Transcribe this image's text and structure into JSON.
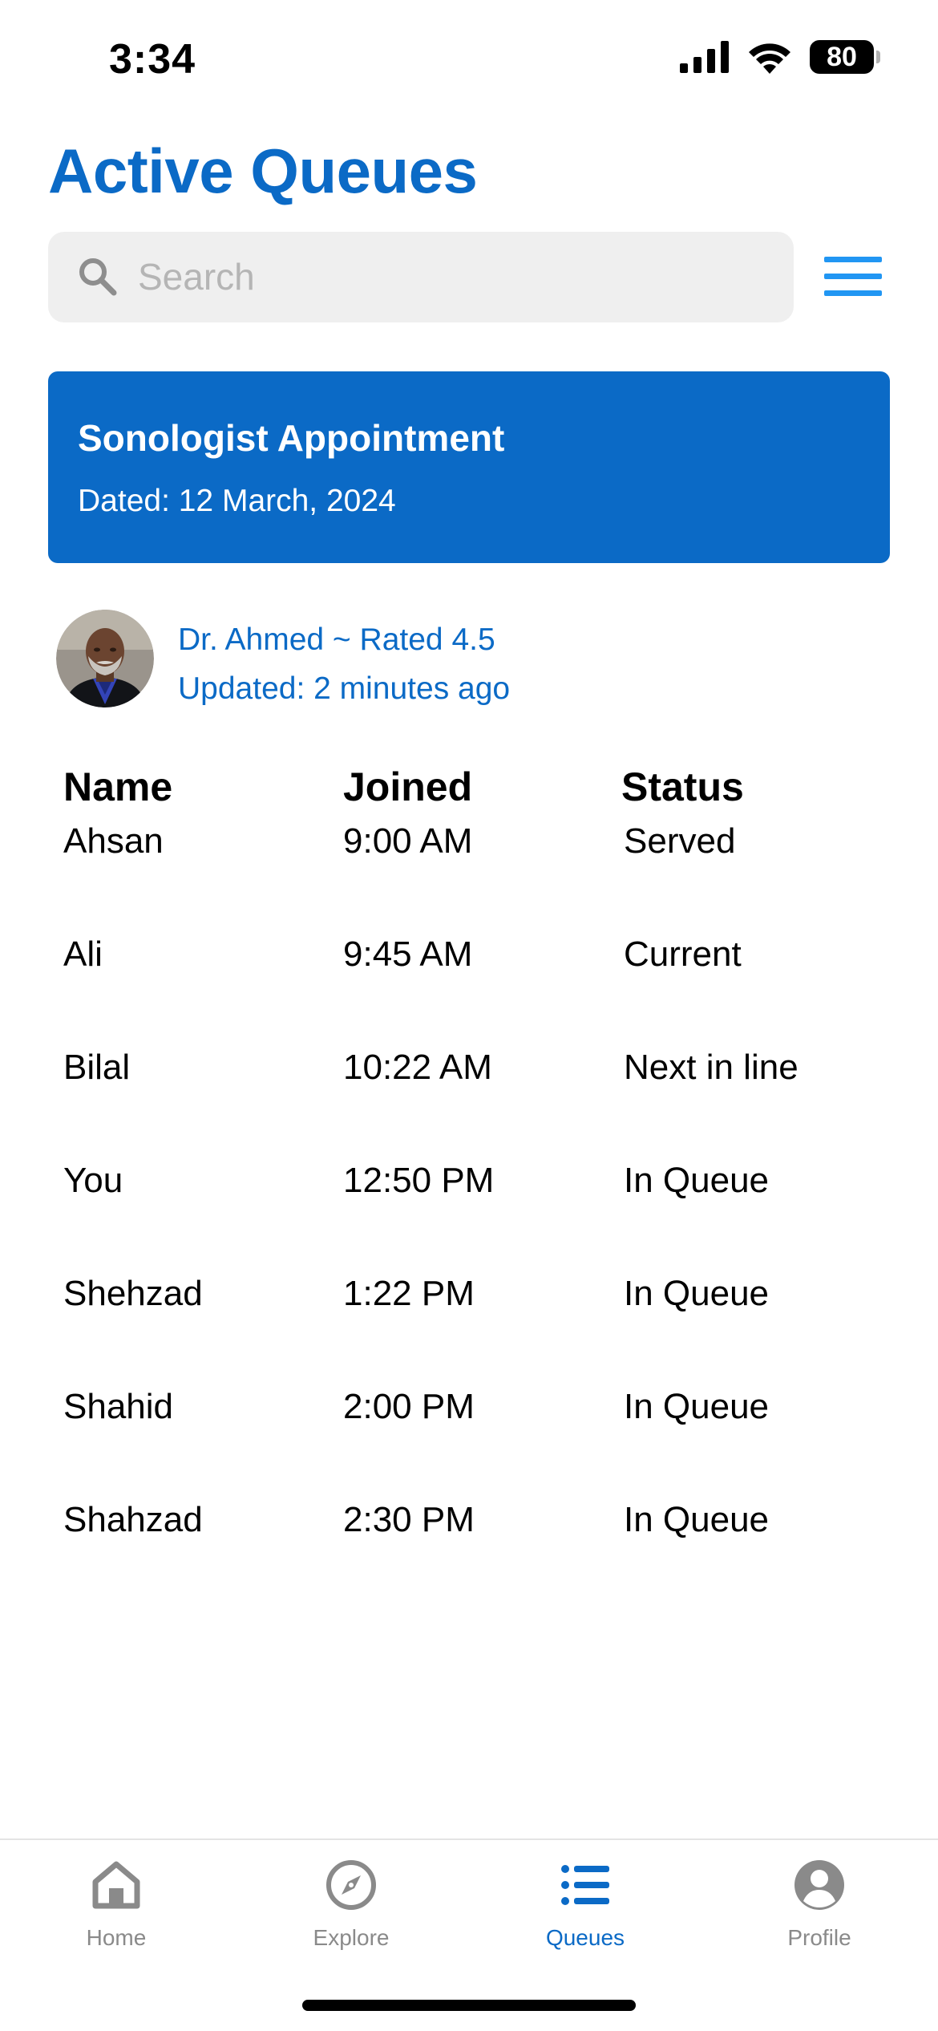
{
  "status_bar": {
    "time": "3:34",
    "battery": "80",
    "icons": [
      "signal-icon",
      "wifi-icon",
      "battery-icon"
    ]
  },
  "header": {
    "title": "Active Queues"
  },
  "search": {
    "placeholder": "Search",
    "value": "",
    "icon": "search-icon"
  },
  "menu": {
    "icon": "hamburger-menu-icon"
  },
  "appointment": {
    "title": "Sonologist Appointment",
    "date": "Dated: 12 March, 2024"
  },
  "doctor": {
    "info": "Dr. Ahmed ~ Rated 4.5",
    "updated": "Updated: 2 minutes ago"
  },
  "table": {
    "headers": [
      "Name",
      "Joined",
      "Status"
    ],
    "rows": [
      [
        "Ahsan",
        "9:00 AM",
        "Served"
      ],
      [
        "Ali",
        "9:45 AM",
        "Current"
      ],
      [
        "Bilal",
        "10:22 AM",
        "Next in line"
      ],
      [
        "You",
        "12:50 PM",
        "In Queue"
      ],
      [
        "Shehzad",
        "1:22 PM",
        "In Queue"
      ],
      [
        "Shahid",
        "2:00 PM",
        "In Queue"
      ],
      [
        "Shahzad",
        "2:30 PM",
        "In Queue"
      ]
    ]
  },
  "tabs": [
    {
      "label": "Home",
      "icon": "home-icon",
      "active": false
    },
    {
      "label": "Explore",
      "icon": "compass-icon",
      "active": false
    },
    {
      "label": "Queues",
      "icon": "list-icon",
      "active": true
    },
    {
      "label": "Profile",
      "icon": "profile-icon",
      "active": false
    }
  ],
  "colors": {
    "accent": "#0b6ac6",
    "menu_icon": "#2196f3",
    "tab_inactive": "#8a8a8a",
    "search_bg": "#efefef"
  }
}
